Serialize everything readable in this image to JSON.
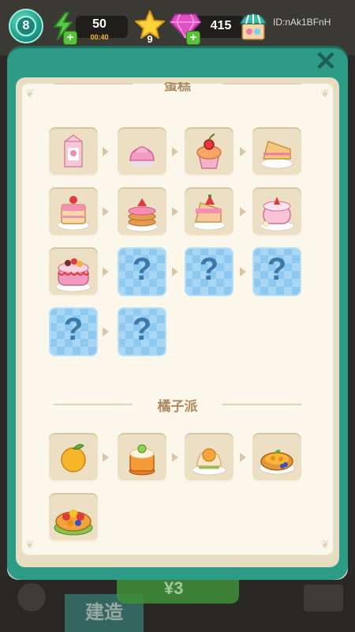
{
  "top_bar": {
    "level": "8",
    "energy": "50",
    "energy_timer": "00:40",
    "stars": "9",
    "gems": "415",
    "player_id": "ID:nAk1BFnH"
  },
  "background": {
    "buy_price": "¥3",
    "build_label": "建造"
  },
  "sections": [
    {
      "title": "蛋糕",
      "items": [
        {
          "icon": "milk-carton-icon",
          "locked": false
        },
        {
          "icon": "pink-cream-swirl-icon",
          "locked": false
        },
        {
          "icon": "cherry-cupcake-icon",
          "locked": false
        },
        {
          "icon": "cake-slice-icon",
          "locked": false
        },
        {
          "icon": "cherry-layer-cake-slice-icon",
          "locked": false
        },
        {
          "icon": "strawberry-pancakes-icon",
          "locked": false
        },
        {
          "icon": "strawberry-cake-slice-icon",
          "locked": false
        },
        {
          "icon": "strawberry-round-cake-icon",
          "locked": false
        },
        {
          "icon": "fruit-birthday-cake-icon",
          "locked": false
        },
        {
          "icon": "question-mark-icon",
          "locked": true,
          "text": "?"
        },
        {
          "icon": "question-mark-icon",
          "locked": true,
          "text": "?"
        },
        {
          "icon": "question-mark-icon",
          "locked": true,
          "text": "?"
        },
        {
          "icon": "question-mark-icon",
          "locked": true,
          "text": "?"
        },
        {
          "icon": "question-mark-icon",
          "locked": true,
          "text": "?"
        }
      ]
    },
    {
      "title": "橘子派",
      "items": [
        {
          "icon": "orange-fruit-icon",
          "locked": false
        },
        {
          "icon": "orange-pudding-icon",
          "locked": false
        },
        {
          "icon": "orange-cream-dessert-icon",
          "locked": false
        },
        {
          "icon": "orange-tart-icon",
          "locked": false
        },
        {
          "icon": "fruit-tart-icon",
          "locked": false
        }
      ]
    }
  ]
}
